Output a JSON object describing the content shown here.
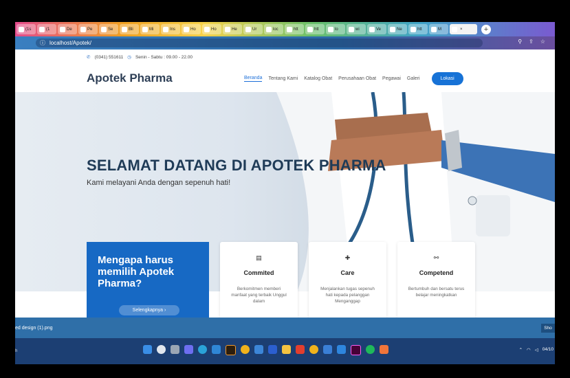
{
  "browser": {
    "tabs": [
      {
        "label": "(1s"
      },
      {
        "label": "(1"
      },
      {
        "label": "De"
      },
      {
        "label": "Pe"
      },
      {
        "label": "Se"
      },
      {
        "label": "Bli"
      },
      {
        "label": "Mi"
      },
      {
        "label": "Ins"
      },
      {
        "label": "Ho"
      },
      {
        "label": "Ho"
      },
      {
        "label": "He"
      },
      {
        "label": "Ur"
      },
      {
        "label": "loc"
      },
      {
        "label": "htt"
      },
      {
        "label": "htt"
      },
      {
        "label": "lo"
      },
      {
        "label": "wi"
      },
      {
        "label": "Ve"
      },
      {
        "label": "Ne"
      },
      {
        "label": "htt"
      },
      {
        "label": "M"
      },
      {
        "label": ""
      }
    ],
    "new_tab_symbol": "+",
    "close_symbol": "×",
    "url": "localhost/Apotek/",
    "accent": "#2b6aa6"
  },
  "site": {
    "phone": "(0341) 551611",
    "hours": "Senin - Sabtu : 09.00 - 22.00",
    "brand": "Apotek Pharma",
    "menu": [
      "Beranda",
      "Tentang Kami",
      "Katalog Obat",
      "Perusahaan Obat",
      "Pegawai",
      "Galeri"
    ],
    "cta": "Lokasi",
    "hero_title": "SELAMAT DATANG DI APOTEK PHARMA",
    "hero_subtitle": "Kami melayani Anda dengan sepenuh hati!",
    "why_title": "Mengapa harus memilih Apotek Pharma?",
    "why_button": "Selengkapnya",
    "cards": [
      {
        "icon": "document-icon",
        "glyph": "▤",
        "title": "Commited",
        "desc": "Berkomitmen memberi manfaat yang terbaik Unggul dalam"
      },
      {
        "icon": "hand-care-icon",
        "glyph": "✚",
        "title": "Care",
        "desc": "Menjalankan tugas sepenuh hati kepada pelanggan Menganggap"
      },
      {
        "icon": "handshake-icon",
        "glyph": "⚯",
        "title": "Competend",
        "desc": "Bertumbuh dan bersatu terus belajar meningkatkan"
      }
    ],
    "brand_color": "#1769c4"
  },
  "downloads": {
    "file": "ed design (1).png",
    "show_label": "Sho"
  },
  "taskbar": {
    "left_text": "h",
    "date": "04/10"
  }
}
